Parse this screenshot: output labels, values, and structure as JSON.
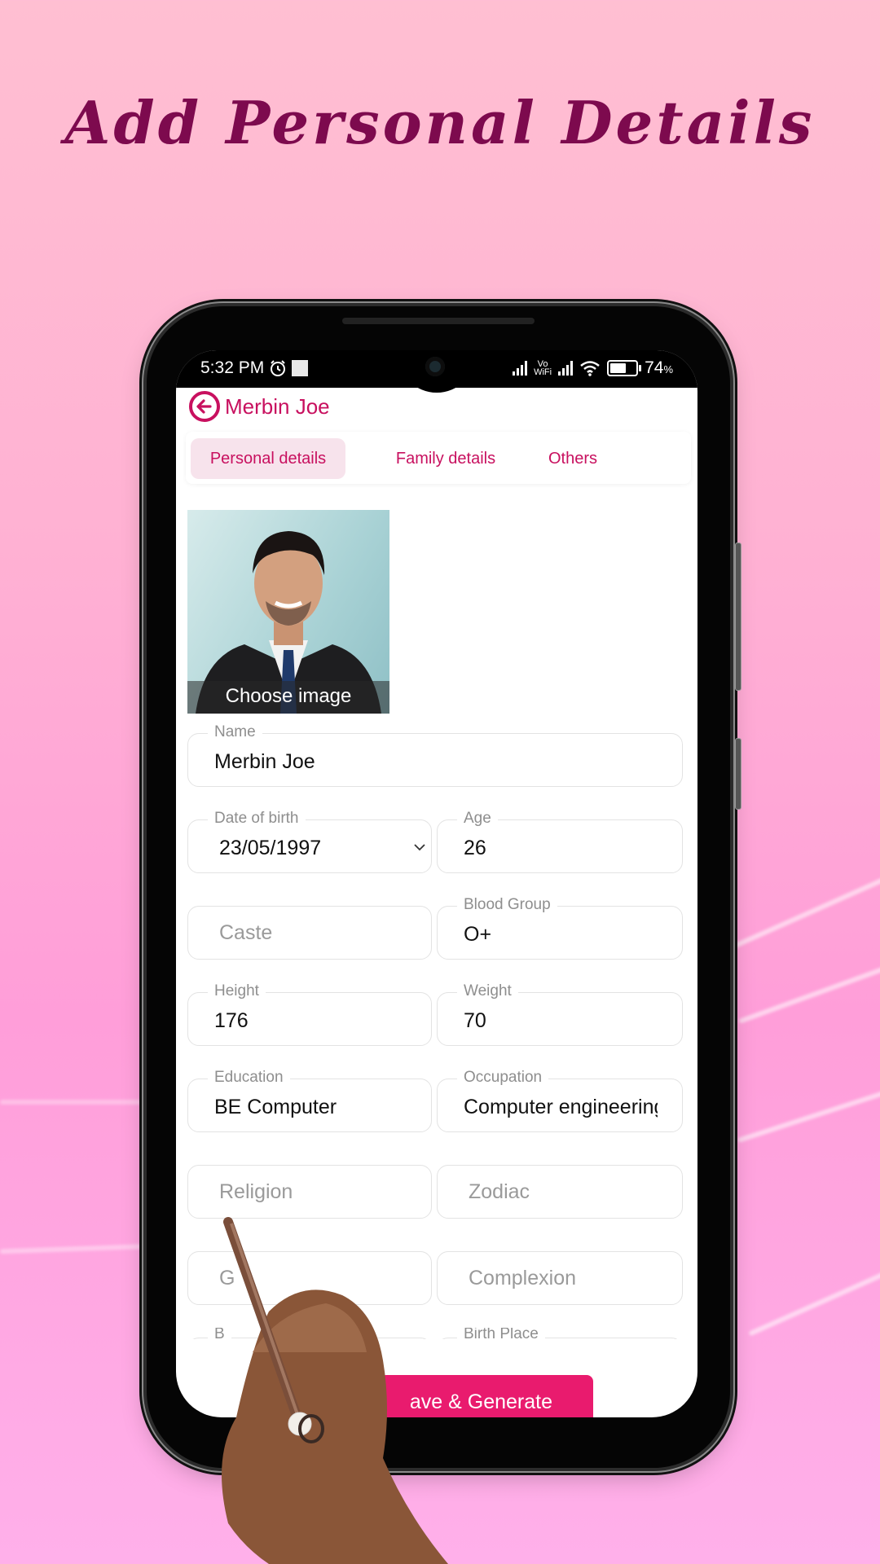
{
  "headline": "Add Personal Details",
  "colors": {
    "accent": "#c8105f",
    "button": "#e91b6e",
    "headline": "#7d0a4e",
    "tab_active_bg": "#f7e3ec"
  },
  "statusbar": {
    "time": "5:32 PM",
    "battery_percent": "74",
    "battery_suffix": "%",
    "vowifi_top": "Vo",
    "vowifi_bottom": "WiFi",
    "battery_level": 0.74
  },
  "appbar": {
    "back_icon": "arrow-left-circle-icon",
    "title": "Merbin Joe"
  },
  "tabs": [
    {
      "label": "Personal details",
      "active": true
    },
    {
      "label": "Family details",
      "active": false
    },
    {
      "label": "Others",
      "active": false
    }
  ],
  "photo": {
    "action_label": "Choose image"
  },
  "form": {
    "name": {
      "label": "Name",
      "value": "Merbin Joe"
    },
    "dob": {
      "label": "Date of birth",
      "value": "23/05/1997"
    },
    "age": {
      "label": "Age",
      "value": "26"
    },
    "caste": {
      "placeholder": "Caste"
    },
    "blood_group": {
      "label": "Blood Group",
      "value": "O+"
    },
    "height": {
      "label": "Height",
      "value": "176"
    },
    "weight": {
      "label": "Weight",
      "value": "70"
    },
    "education": {
      "label": "Education",
      "value": "BE Computer"
    },
    "occupation": {
      "label": "Occupation",
      "value": "Computer engineering"
    },
    "religion": {
      "placeholder": "Religion"
    },
    "zodiac": {
      "placeholder": "Zodiac"
    },
    "gothram_partial": {
      "placeholder": "G"
    },
    "complexion": {
      "placeholder": "Complexion"
    },
    "partial_left_label": "B",
    "birth_place": {
      "label": "Birth Place"
    }
  },
  "save_button": {
    "label": "ave & Generate"
  }
}
